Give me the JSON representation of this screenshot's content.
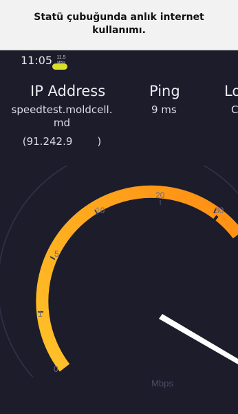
{
  "caption": "Statü çubuğunda anlık internet kullanımı.",
  "status": {
    "time": "11:05",
    "net_value": "11.5",
    "net_unit": "MB/s"
  },
  "metrics": {
    "ip_label": "IP Address",
    "server": "speedtest.moldcell.md",
    "ip": "(91.242.9",
    "ip_end": ")",
    "ping_label": "Ping",
    "ping_value": "9 ms",
    "loss_label": "Lo",
    "loss_value": "C"
  },
  "gauge": {
    "tick_labels": [
      "0",
      "1",
      "5",
      "10",
      "20",
      "30"
    ],
    "unit": "Mbps",
    "arc_color": "#ffad1f",
    "needle_color": "#ffffff"
  }
}
